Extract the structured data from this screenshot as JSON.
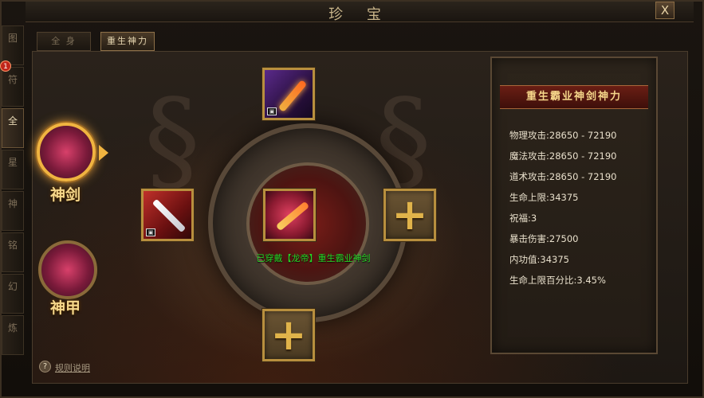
{
  "window": {
    "title": "珍 宝",
    "close_label": "X"
  },
  "side_tabs": [
    {
      "label": "图"
    },
    {
      "label": "符",
      "badge": "1"
    },
    {
      "label": "全"
    },
    {
      "label": "星"
    },
    {
      "label": "神"
    },
    {
      "label": "铭"
    },
    {
      "label": "幻"
    },
    {
      "label": "炼"
    }
  ],
  "top_tabs": [
    {
      "label": "全 身"
    },
    {
      "label": "重生神力"
    }
  ],
  "categories": [
    {
      "label": "神剑",
      "icon": "divine-sword-icon",
      "active": true
    },
    {
      "label": "神甲",
      "icon": "divine-armor-icon",
      "active": false
    }
  ],
  "slots": {
    "top": {
      "item": "purple-sword"
    },
    "left": {
      "item": "red-blade"
    },
    "center": {
      "item": "dragon-emperor-sword"
    },
    "right": {
      "item": "empty",
      "symbol": "+"
    },
    "bottom": {
      "item": "empty",
      "symbol": "+"
    }
  },
  "equipped_text": "已穿戴【龙帝】重生霸业神剑",
  "help": {
    "icon": "question-icon",
    "label": "规则说明"
  },
  "stats": {
    "title": "重生霸业神剑神力",
    "lines": [
      "物理攻击:28650 - 72190",
      "魔法攻击:28650 - 72190",
      "道术攻击:28650 - 72190",
      "生命上限:34375",
      "祝福:3",
      "暴击伤害:27500",
      "内功值:34375",
      "生命上限百分比:3.45%"
    ]
  },
  "colors": {
    "accent_gold": "#e0b34a",
    "equipped_green": "#26d626",
    "banner_red": "#6a1e14"
  }
}
